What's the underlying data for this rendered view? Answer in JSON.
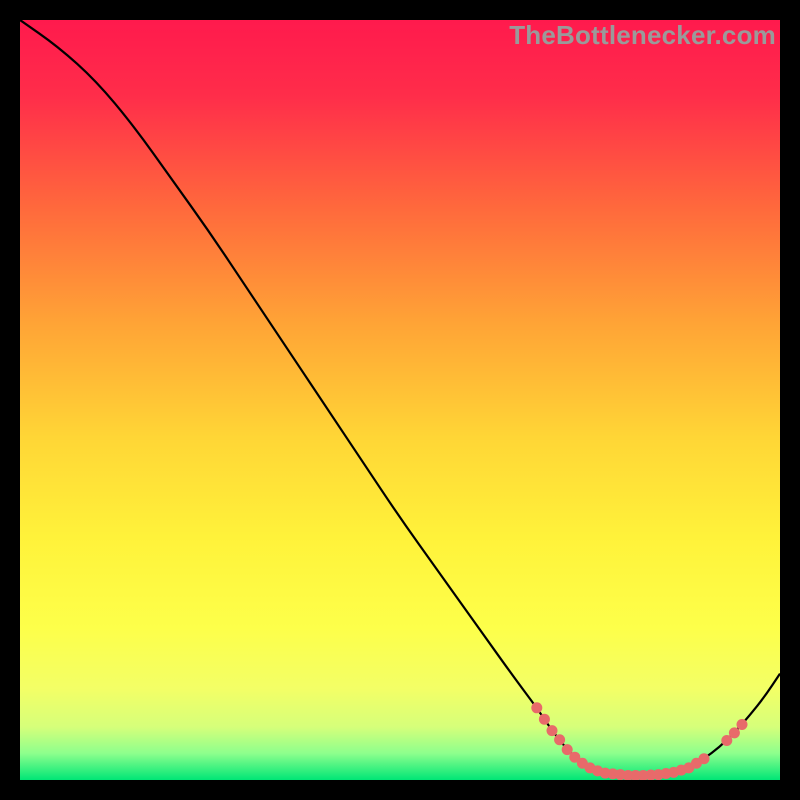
{
  "watermark": "TheBottlenecker.com",
  "chart_data": {
    "type": "line",
    "title": "",
    "xlabel": "",
    "ylabel": "",
    "xlim": [
      0,
      100
    ],
    "ylim": [
      0,
      100
    ],
    "grid": false,
    "curve": [
      {
        "x": 0.0,
        "y": 100.0
      },
      {
        "x": 5.0,
        "y": 96.5
      },
      {
        "x": 10.0,
        "y": 92.0
      },
      {
        "x": 15.0,
        "y": 86.0
      },
      {
        "x": 20.0,
        "y": 79.0
      },
      {
        "x": 25.0,
        "y": 72.0
      },
      {
        "x": 30.0,
        "y": 64.5
      },
      {
        "x": 35.0,
        "y": 57.0
      },
      {
        "x": 40.0,
        "y": 49.5
      },
      {
        "x": 45.0,
        "y": 42.0
      },
      {
        "x": 50.0,
        "y": 34.5
      },
      {
        "x": 55.0,
        "y": 27.5
      },
      {
        "x": 60.0,
        "y": 20.5
      },
      {
        "x": 65.0,
        "y": 13.5
      },
      {
        "x": 68.0,
        "y": 9.5
      },
      {
        "x": 70.0,
        "y": 6.5
      },
      {
        "x": 72.0,
        "y": 4.0
      },
      {
        "x": 74.0,
        "y": 2.2
      },
      {
        "x": 76.0,
        "y": 1.2
      },
      {
        "x": 78.0,
        "y": 0.8
      },
      {
        "x": 80.0,
        "y": 0.6
      },
      {
        "x": 82.0,
        "y": 0.6
      },
      {
        "x": 84.0,
        "y": 0.7
      },
      {
        "x": 86.0,
        "y": 1.0
      },
      {
        "x": 88.0,
        "y": 1.6
      },
      {
        "x": 90.0,
        "y": 2.8
      },
      {
        "x": 92.0,
        "y": 4.3
      },
      {
        "x": 94.0,
        "y": 6.2
      },
      {
        "x": 96.0,
        "y": 8.5
      },
      {
        "x": 98.0,
        "y": 11.0
      },
      {
        "x": 100.0,
        "y": 14.0
      }
    ],
    "markers": [
      {
        "x": 68.0,
        "y": 9.5
      },
      {
        "x": 69.0,
        "y": 8.0
      },
      {
        "x": 70.0,
        "y": 6.5
      },
      {
        "x": 71.0,
        "y": 5.3
      },
      {
        "x": 72.0,
        "y": 4.0
      },
      {
        "x": 73.0,
        "y": 3.0
      },
      {
        "x": 74.0,
        "y": 2.2
      },
      {
        "x": 75.0,
        "y": 1.6
      },
      {
        "x": 76.0,
        "y": 1.2
      },
      {
        "x": 77.0,
        "y": 0.9
      },
      {
        "x": 78.0,
        "y": 0.8
      },
      {
        "x": 79.0,
        "y": 0.7
      },
      {
        "x": 80.0,
        "y": 0.6
      },
      {
        "x": 81.0,
        "y": 0.6
      },
      {
        "x": 82.0,
        "y": 0.6
      },
      {
        "x": 83.0,
        "y": 0.65
      },
      {
        "x": 84.0,
        "y": 0.7
      },
      {
        "x": 85.0,
        "y": 0.85
      },
      {
        "x": 86.0,
        "y": 1.0
      },
      {
        "x": 87.0,
        "y": 1.3
      },
      {
        "x": 88.0,
        "y": 1.6
      },
      {
        "x": 89.0,
        "y": 2.2
      },
      {
        "x": 90.0,
        "y": 2.8
      },
      {
        "x": 93.0,
        "y": 5.2
      },
      {
        "x": 94.0,
        "y": 6.2
      },
      {
        "x": 95.0,
        "y": 7.3
      }
    ],
    "series": [
      {
        "name": "bottleneck-curve",
        "color": "#000000"
      },
      {
        "name": "markers",
        "color": "#e86a6a"
      }
    ],
    "gradient_stops": [
      {
        "pos": 0.0,
        "color": "#ff1a4d"
      },
      {
        "pos": 0.1,
        "color": "#ff2d4a"
      },
      {
        "pos": 0.25,
        "color": "#ff6a3c"
      },
      {
        "pos": 0.4,
        "color": "#ffa436"
      },
      {
        "pos": 0.55,
        "color": "#ffd636"
      },
      {
        "pos": 0.68,
        "color": "#fff23a"
      },
      {
        "pos": 0.8,
        "color": "#fdff4a"
      },
      {
        "pos": 0.88,
        "color": "#f3ff66"
      },
      {
        "pos": 0.93,
        "color": "#d6ff7a"
      },
      {
        "pos": 0.965,
        "color": "#8dff8d"
      },
      {
        "pos": 1.0,
        "color": "#00e676"
      }
    ]
  }
}
